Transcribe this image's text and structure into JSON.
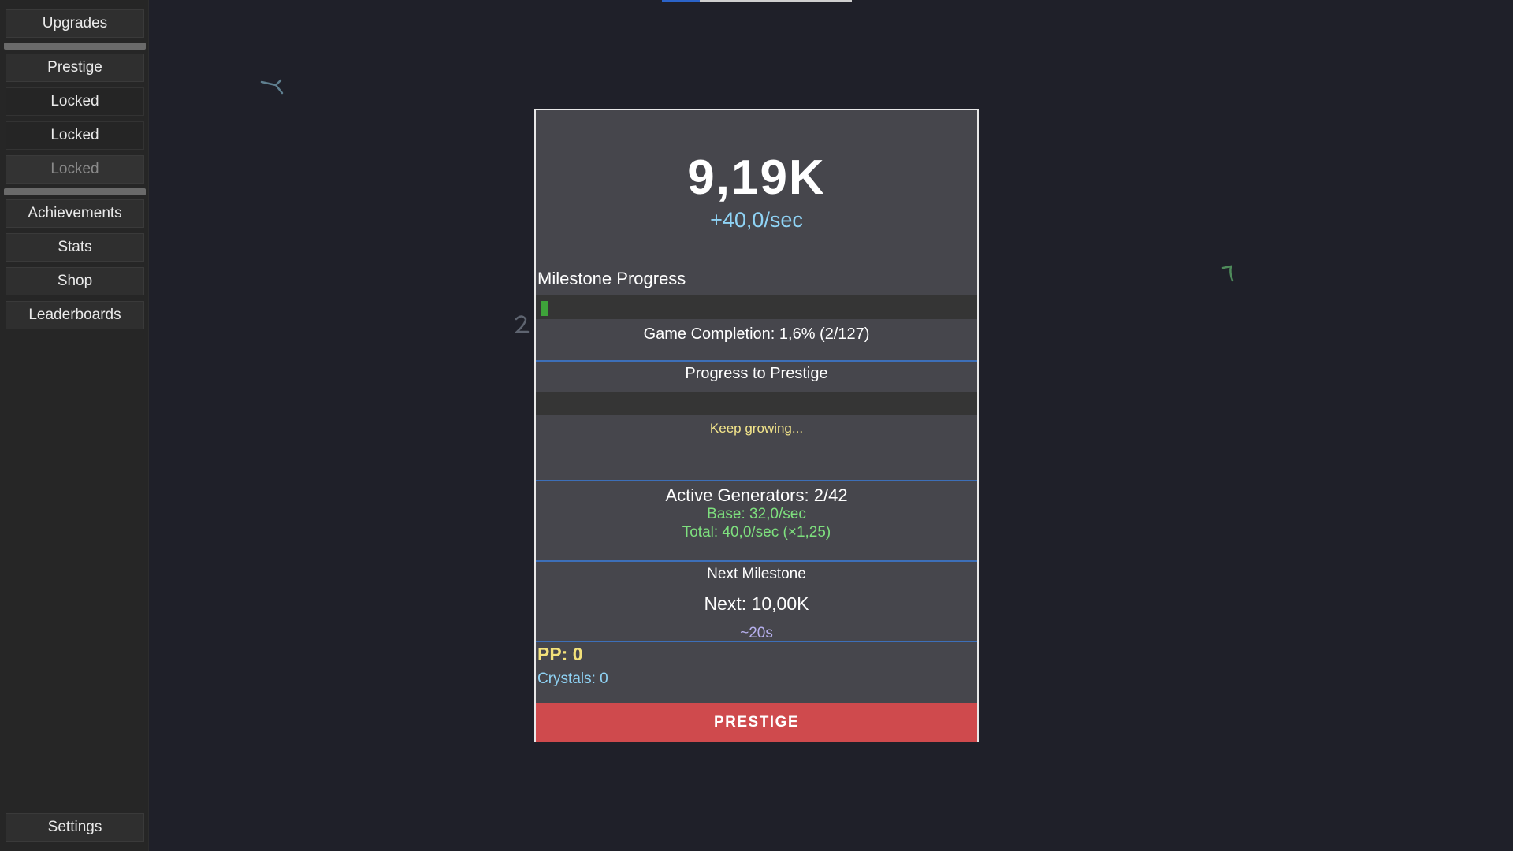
{
  "sidebar": {
    "items": [
      {
        "label": "Upgrades"
      },
      {
        "label": "Prestige"
      },
      {
        "label": "Locked"
      },
      {
        "label": "Locked"
      },
      {
        "label": "Locked"
      },
      {
        "label": "Achievements"
      },
      {
        "label": "Stats"
      },
      {
        "label": "Shop"
      },
      {
        "label": "Leaderboards"
      }
    ],
    "settings_label": "Settings"
  },
  "main": {
    "score": "9,19K",
    "rate": "+40,0/sec",
    "milestone_label": "Milestone Progress",
    "milestone_progress": 0.016,
    "completion": "Game Completion: 1,6% (2/127)",
    "prestige_progress_label": "Progress to Prestige",
    "prestige_progress": 0,
    "keep_growing": "Keep growing...",
    "generators_title": "Active Generators: 2/42",
    "generators_base": "Base: 32,0/sec",
    "generators_total": "Total: 40,0/sec (×1,25)",
    "next_milestone_label": "Next Milestone",
    "next_value": "Next: 10,00K",
    "eta": "~20s",
    "pp": "PP: 0",
    "crystals": "Crystals: 0",
    "prestige_button": "PRESTIGE"
  },
  "colors": {
    "background": "#1f2029",
    "panel": "#46464c",
    "accent_blue": "#3d6fb8",
    "prestige_red": "#cf4a4d",
    "progress_green": "#3ea33a",
    "rate_cyan": "#8fd3f5",
    "pp_yellow": "#f3e17a"
  }
}
